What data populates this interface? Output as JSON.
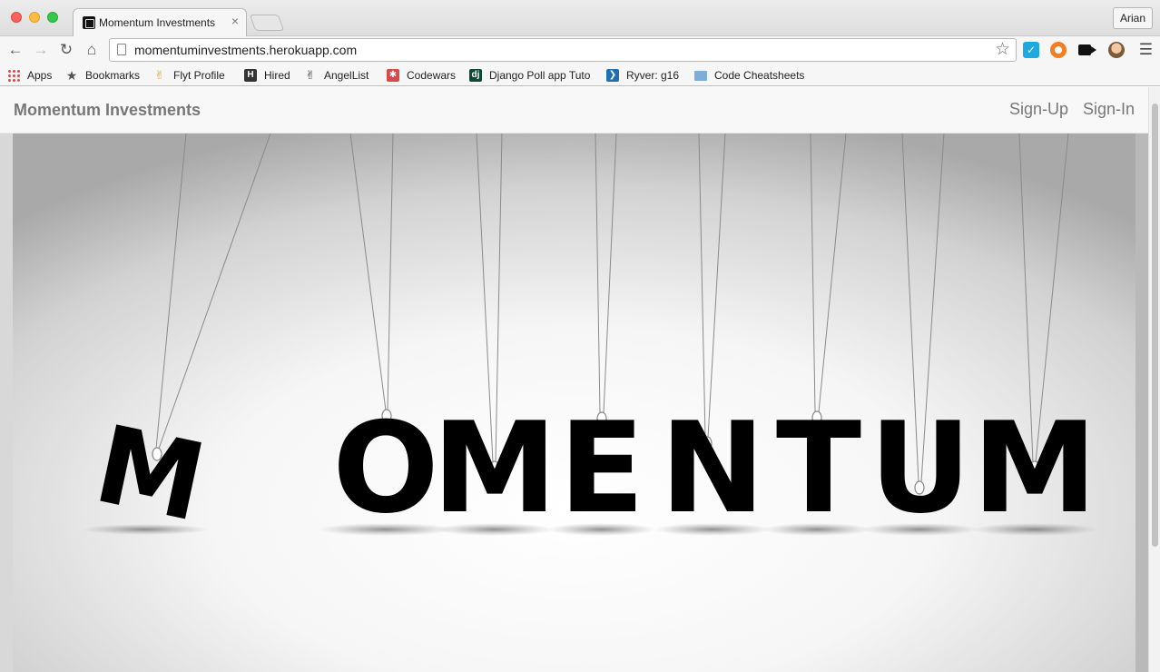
{
  "browser": {
    "tab_title": "Momentum Investments",
    "tab_close": "×",
    "profile_name": "Arian",
    "url": "momentuminvestments.herokuapp.com",
    "bookmarks": [
      {
        "label": "Apps",
        "icon": "apps-icon"
      },
      {
        "label": "Bookmarks",
        "icon": "star-icon"
      },
      {
        "label": "Flyt Profile",
        "icon": "flyt-icon"
      },
      {
        "label": "Hired",
        "icon": "hired-icon"
      },
      {
        "label": "AngelList",
        "icon": "angellist-icon"
      },
      {
        "label": "Codewars",
        "icon": "codewars-icon"
      },
      {
        "label": "Django Poll app Tuto",
        "icon": "django-icon"
      },
      {
        "label": "Ryver: g16",
        "icon": "ryver-icon"
      },
      {
        "label": "Code Cheatsheets",
        "icon": "folder-icon"
      }
    ]
  },
  "navbar": {
    "brand": "Momentum Investments",
    "signup": "Sign-Up",
    "signin": "Sign-In"
  },
  "hero": {
    "letters": [
      "M",
      "O",
      "M",
      "E",
      "N",
      "T",
      "U",
      "M"
    ]
  }
}
